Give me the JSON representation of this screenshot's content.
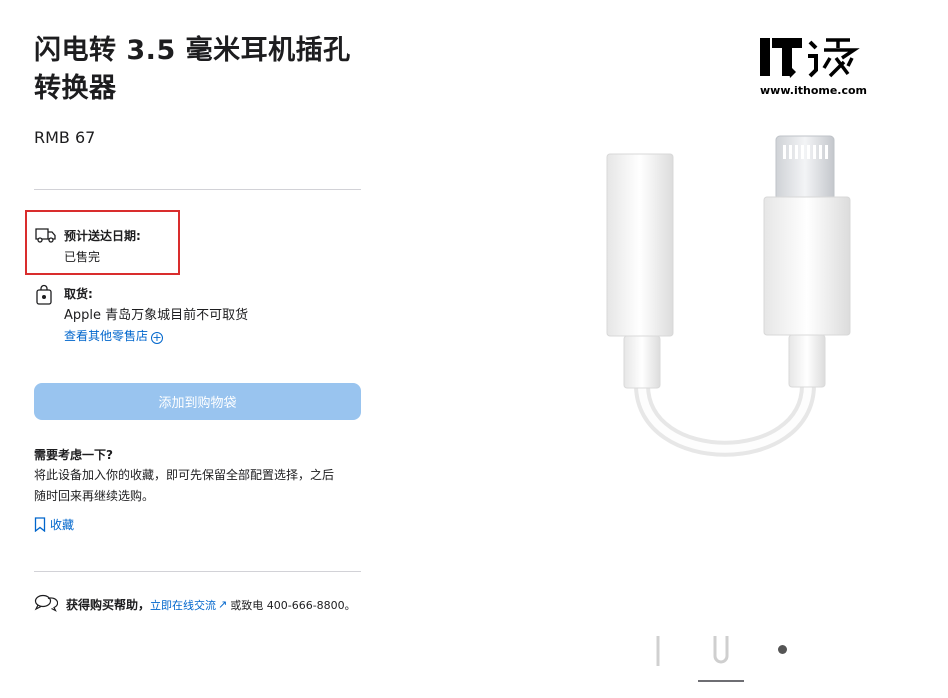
{
  "product": {
    "title_line1": "闪电转 3.5 毫米耳机插孔",
    "title_line2": "转换器",
    "price": "RMB 67"
  },
  "delivery": {
    "label": "预计送达日期:",
    "status": "已售完"
  },
  "pickup": {
    "label": "取货:",
    "store_text": "Apple 青岛万象城目前不可取货",
    "other_stores_link": "查看其他零售店",
    "plus_glyph": "+"
  },
  "cart": {
    "add_button_label": "添加到购物袋",
    "button_color": "#99c4ef"
  },
  "consider": {
    "title": "需要考虑一下?",
    "line1": "将此设备加入你的收藏，即可先保留全部配置选择，之后",
    "line2": "随时回来再继续选购。",
    "save_label": "收藏"
  },
  "help": {
    "prefix": "获得购买帮助，",
    "chat_link": "立即在线交流",
    "chat_arrow": "↗",
    "phone_text": "或致电 400-666-8800。"
  },
  "watermark": {
    "logo_text": "IT之家",
    "url": "www.ithome.com"
  },
  "colors": {
    "accent": "#0066cc",
    "highlight_box": "#d92d2d",
    "divider": "#d2d2d7"
  },
  "icons": [
    "truck-icon",
    "bag-icon",
    "plus-circle-icon",
    "bookmark-icon",
    "chat-bubbles-icon",
    "external-arrow-icon"
  ]
}
